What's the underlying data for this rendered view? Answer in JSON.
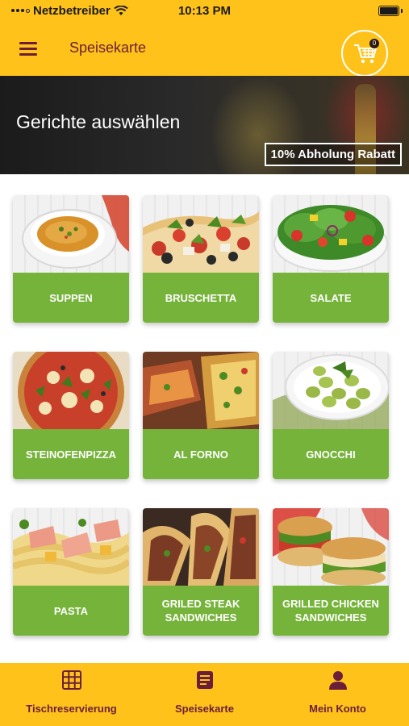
{
  "status_bar": {
    "carrier": "Netzbetreiber",
    "time": "10:13 PM"
  },
  "header": {
    "title": "Speisekarte",
    "cart_count": "0"
  },
  "banner": {
    "title": "Gerichte auswählen",
    "discount": "10% Abholung Rabatt"
  },
  "categories": [
    {
      "label": "SUPPEN",
      "icon": "soup-image"
    },
    {
      "label": "BRUSCHETTA",
      "icon": "bruschetta-image"
    },
    {
      "label": "SALATE",
      "icon": "salad-image"
    },
    {
      "label": "STEINOFENPIZZA",
      "icon": "pizza-image"
    },
    {
      "label": "AL FORNO",
      "icon": "al-forno-image"
    },
    {
      "label": "GNOCCHI",
      "icon": "gnocchi-image"
    },
    {
      "label": "PASTA",
      "icon": "pasta-image"
    },
    {
      "label": "GRILED STEAK\nSANDWICHES",
      "icon": "steak-sandwich-image"
    },
    {
      "label": "GRILLED CHICKEN\nSANDWICHES",
      "icon": "chicken-sandwich-image"
    }
  ],
  "bottom_nav": [
    {
      "label": "Tischreservierung",
      "icon": "grid-icon"
    },
    {
      "label": "Speisekarte",
      "icon": "menu-book-icon"
    },
    {
      "label": "Mein Konto",
      "icon": "person-icon"
    }
  ],
  "colors": {
    "primary_yellow": "#FFC21A",
    "accent_maroon": "#6B1E3A",
    "card_green": "#76B33A"
  }
}
